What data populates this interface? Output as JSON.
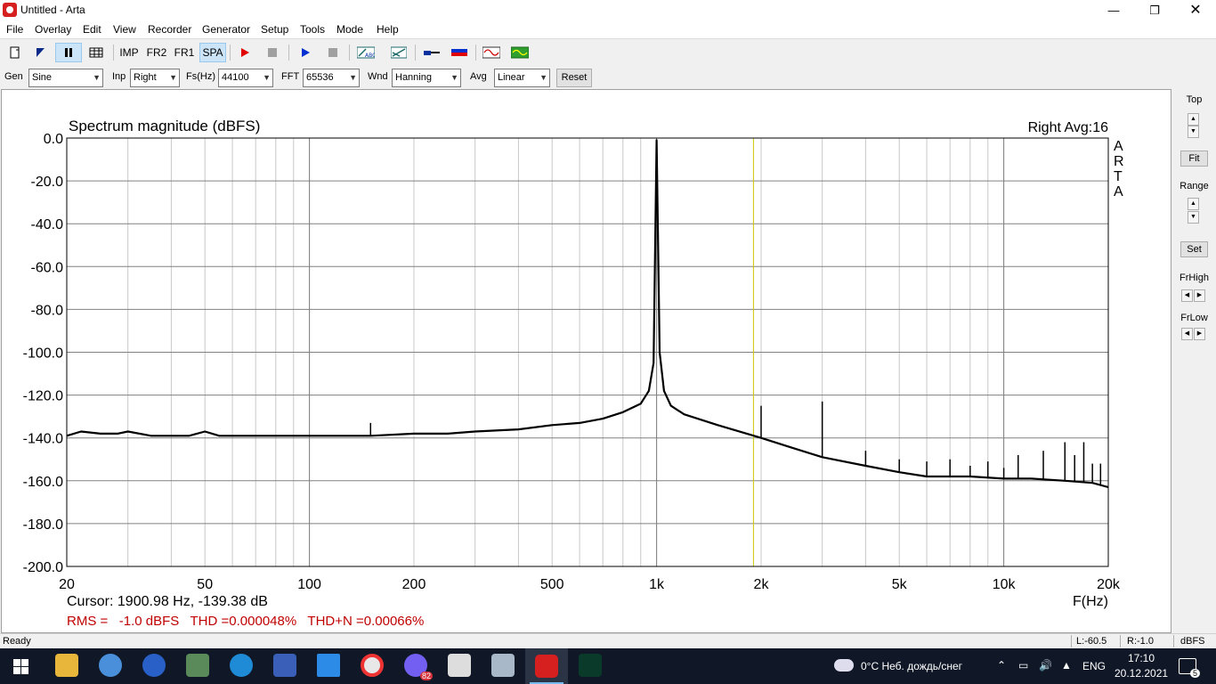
{
  "window": {
    "title": "Untitled - Arta"
  },
  "menu": [
    "File",
    "Overlay",
    "Edit",
    "View",
    "Recorder",
    "Generator",
    "Setup",
    "Tools",
    "Mode",
    "Help"
  ],
  "toolbar": {
    "imp": "IMP",
    "fr2": "FR2",
    "fr1": "FR1",
    "spa": "SPA"
  },
  "params": {
    "gen_label": "Gen",
    "gen_value": "Sine",
    "inp_label": "Inp",
    "inp_value": "Right",
    "fs_label": "Fs(Hz)",
    "fs_value": "44100",
    "fft_label": "FFT",
    "fft_value": "65536",
    "wnd_label": "Wnd",
    "wnd_value": "Hanning",
    "avg_label": "Avg",
    "avg_value": "Linear",
    "reset_label": "Reset"
  },
  "right_panel": {
    "top_label": "Top",
    "fit_label": "Fit",
    "range_label": "Range",
    "set_label": "Set",
    "frhigh_label": "FrHigh",
    "frlow_label": "FrLow"
  },
  "chart_data": {
    "type": "line",
    "title": "Spectrum magnitude (dBFS)",
    "channel_info": "Right  Avg:16",
    "watermark": "ARTA",
    "xlabel": "F(Hz)",
    "xscale": "log",
    "xlim": [
      20,
      20000
    ],
    "ylim": [
      -200,
      0
    ],
    "x_tick_labels": [
      "20",
      "50",
      "100",
      "200",
      "500",
      "1k",
      "2k",
      "5k",
      "10k",
      "20k"
    ],
    "x_tick_values": [
      20,
      50,
      100,
      200,
      500,
      1000,
      2000,
      5000,
      10000,
      20000
    ],
    "y_tick_labels": [
      "0.0",
      "-20.0",
      "-40.0",
      "-60.0",
      "-80.0",
      "-100.0",
      "-120.0",
      "-140.0",
      "-160.0",
      "-180.0",
      "-200.0"
    ],
    "y_tick_values": [
      0,
      -20,
      -40,
      -60,
      -80,
      -100,
      -120,
      -140,
      -160,
      -180,
      -200
    ],
    "grid": true,
    "cursor_freq": 1900.98,
    "cursor_text": "Cursor: 1900.98 Hz, -139.38 dB",
    "measurements_text": "RMS =   -1.0 dBFS   THD =0.000048%   THD+N =0.00066%",
    "series": [
      {
        "color": "#000000",
        "x": [
          20,
          22,
          25,
          28,
          30,
          35,
          40,
          45,
          50,
          55,
          60,
          70,
          80,
          90,
          100,
          120,
          150,
          200,
          250,
          300,
          400,
          500,
          600,
          700,
          800,
          900,
          950,
          980,
          1000,
          1020,
          1050,
          1100,
          1200,
          1500,
          2000,
          2500,
          3000,
          4000,
          5000,
          6000,
          8000,
          10000,
          12000,
          15000,
          18000,
          20000
        ],
        "y": [
          -139,
          -137,
          -138,
          -138,
          -137,
          -139,
          -139,
          -139,
          -137,
          -139,
          -139,
          -139,
          -139,
          -139,
          -139,
          -139,
          -139,
          -138,
          -138,
          -137,
          -136,
          -134,
          -133,
          -131,
          -128,
          -124,
          -118,
          -105,
          -1,
          -100,
          -118,
          -125,
          -129,
          -134,
          -140,
          -145,
          -149,
          -153,
          -156,
          -158,
          -158,
          -159,
          -159,
          -160,
          -161,
          -163
        ]
      }
    ],
    "harmonics": [
      {
        "freq": 150,
        "level": -133
      },
      {
        "freq": 2000,
        "level": -125
      },
      {
        "freq": 3000,
        "level": -123
      },
      {
        "freq": 4000,
        "level": -146
      },
      {
        "freq": 5000,
        "level": -150
      },
      {
        "freq": 6000,
        "level": -151
      },
      {
        "freq": 7000,
        "level": -150
      },
      {
        "freq": 8000,
        "level": -153
      },
      {
        "freq": 9000,
        "level": -151
      },
      {
        "freq": 10000,
        "level": -154
      },
      {
        "freq": 11000,
        "level": -148
      },
      {
        "freq": 13000,
        "level": -146
      },
      {
        "freq": 15000,
        "level": -142
      },
      {
        "freq": 16000,
        "level": -148
      },
      {
        "freq": 17000,
        "level": -142
      },
      {
        "freq": 18000,
        "level": -152
      },
      {
        "freq": 19000,
        "level": -152
      }
    ]
  },
  "status": {
    "ready": "Ready",
    "left_level": "L:-60.5",
    "right_level": "R:-1.0",
    "unit": "dBFS"
  },
  "taskbar": {
    "weather": "0°C  Неб. дождь/снег",
    "lang": "ENG",
    "time": "17:10",
    "date": "20.12.2021",
    "viber_badge": "82",
    "notif_count": "5"
  }
}
